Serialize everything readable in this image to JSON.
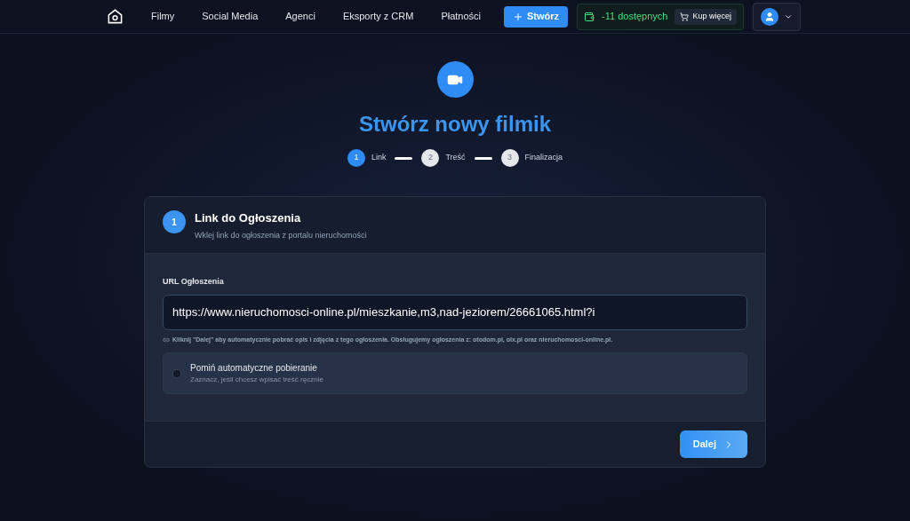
{
  "nav": {
    "items": [
      "Filmy",
      "Social Media",
      "Agenci",
      "Eksporty z CRM",
      "Płatności"
    ],
    "create_button": "Stwórz",
    "credits": {
      "text": "-11 dostępnych",
      "buy_button": "Kup więcej"
    }
  },
  "page": {
    "title": "Stwórz nowy filmik",
    "steps": [
      {
        "number": "1",
        "label": "Link",
        "selected": true
      },
      {
        "number": "2",
        "label": "Treść",
        "selected": false
      },
      {
        "number": "3",
        "label": "Finalizacja",
        "selected": false
      }
    ]
  },
  "card": {
    "step_number": "1",
    "title": "Link do Ogłoszenia",
    "subtitle": "Wklej link do ogłoszenia z portalu nieruchomości",
    "url_label": "URL Ogłoszenia",
    "url_value": "https://www.nieruchomosci-online.pl/mieszkanie,m3,nad-jeziorem/26661065.html?i",
    "hint": "Kliknij \"Dalej\" aby automatycznie pobrać opis i zdjęcia z tego ogłoszenia. Obsługujemy ogłoszenia z: otodom.pl, olx.pl oraz nieruchomosci-online.pl.",
    "skip": {
      "label": "Pomiń automatyczne pobieranie",
      "description": "Zaznacz, jeśli chcesz wpisać treść ręcznie",
      "checked": false
    },
    "next_button": "Dalej"
  }
}
